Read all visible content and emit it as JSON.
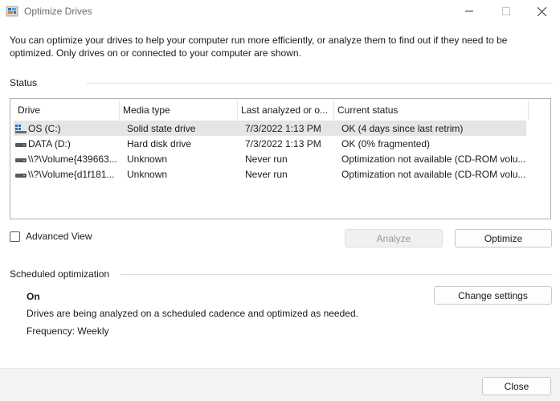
{
  "window": {
    "title": "Optimize Drives",
    "icons": {
      "app": "defrag-app-icon",
      "minimize": "minimize-icon",
      "maximize": "maximize-icon",
      "close": "close-icon"
    }
  },
  "description": "You can optimize your drives to help your computer run more efficiently, or analyze them to find out if they need to be optimized. Only drives on or connected to your computer are shown.",
  "status_section": {
    "label": "Status",
    "columns": [
      "Drive",
      "Media type",
      "Last analyzed or o...",
      "Current status"
    ],
    "rows": [
      {
        "drive": "OS (C:)",
        "icon": "os-drive-icon",
        "media": "Solid state drive",
        "last": "7/3/2022 1:13 PM",
        "status": "OK (4 days since last retrim)"
      },
      {
        "drive": "DATA (D:)",
        "icon": "hard-drive-icon",
        "media": "Hard disk drive",
        "last": "7/3/2022 1:13 PM",
        "status": "OK (0% fragmented)"
      },
      {
        "drive": "\\\\?\\Volume{439663...",
        "icon": "hard-drive-icon",
        "media": "Unknown",
        "last": "Never run",
        "status": "Optimization not available (CD-ROM volu..."
      },
      {
        "drive": "\\\\?\\Volume{d1f181...",
        "icon": "hard-drive-icon",
        "media": "Unknown",
        "last": "Never run",
        "status": "Optimization not available (CD-ROM volu..."
      }
    ],
    "advanced_view_label": "Advanced View",
    "analyze_label": "Analyze",
    "optimize_label": "Optimize"
  },
  "scheduled_section": {
    "label": "Scheduled optimization",
    "status": "On",
    "description": "Drives are being analyzed on a scheduled cadence and optimized as needed.",
    "frequency": "Frequency: Weekly",
    "change_settings_label": "Change settings"
  },
  "footer": {
    "close_label": "Close"
  },
  "colors": {
    "selected_row": "#e5e5e5",
    "os_icon_blue": "#1f6fc0",
    "section_line": "#dcdcdc"
  }
}
